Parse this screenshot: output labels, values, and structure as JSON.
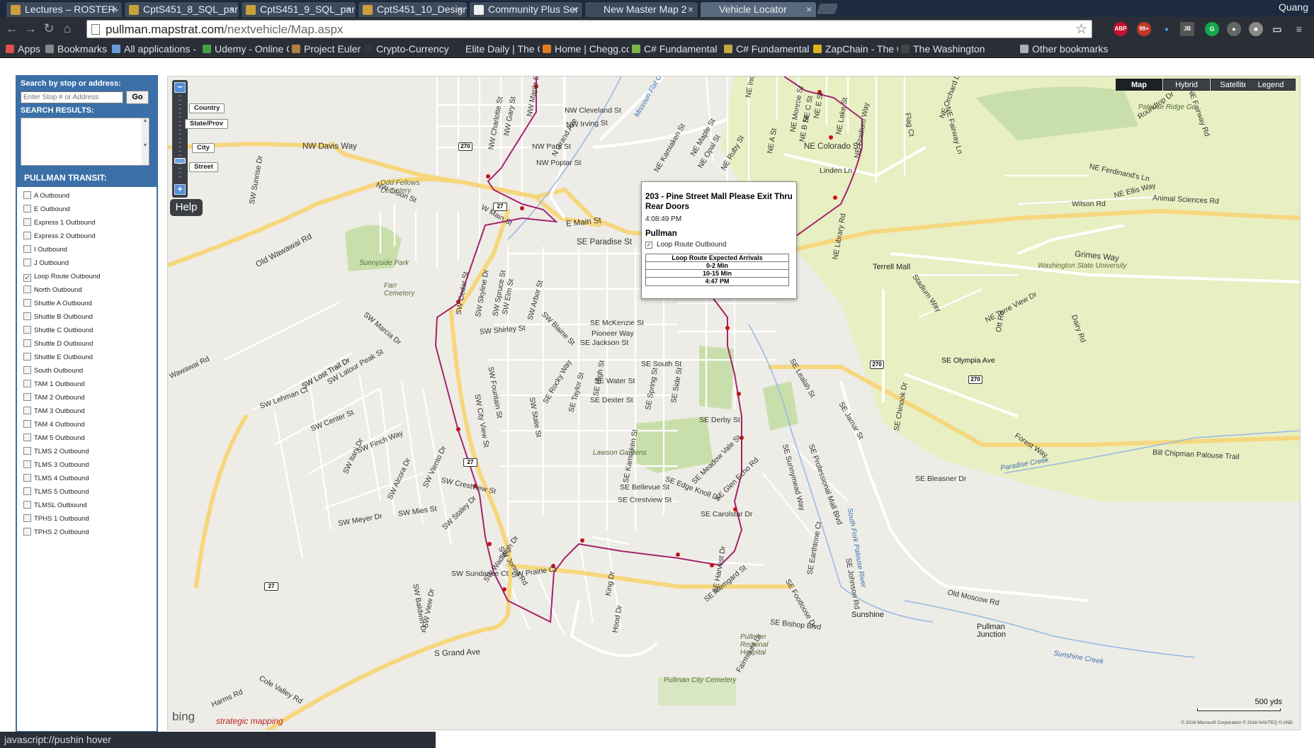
{
  "browser": {
    "tabs": [
      {
        "title": "Lectures – ROSTER-",
        "active": false
      },
      {
        "title": "CptS451_8_SQL_par",
        "active": false
      },
      {
        "title": "CptS451_9_SQL_par",
        "active": false
      },
      {
        "title": "CptS451_10_Design",
        "active": false
      },
      {
        "title": "Community Plus Ser",
        "active": false
      },
      {
        "title": "New Master Map 2",
        "active": false
      },
      {
        "title": "Vehicle Locator",
        "active": true
      }
    ],
    "profile_name": "Quang",
    "url_host": "pullman.mapstrat.com",
    "url_path": "/nextvehicle/Map.aspx",
    "extension_badge": "99+",
    "extension_abp": "ABP",
    "extension_jb": "JB",
    "bookmarks": [
      {
        "label": "Apps",
        "color": "#e05050"
      },
      {
        "label": "Bookmarks",
        "color": "#888888"
      },
      {
        "label": "All applications -",
        "color": "#6a9bd8"
      },
      {
        "label": "Udemy - Online C",
        "color": "#3fa34d"
      },
      {
        "label": "Project Euler",
        "color": "#b08040"
      },
      {
        "label": "Crypto-Currency",
        "color": "#333333"
      },
      {
        "label": "Elite Daily | The C",
        "color": "#2a2f37"
      },
      {
        "label": "Home | Chegg.co",
        "color": "#e27a1f"
      },
      {
        "label": "C# Fundamental",
        "color": "#7ab648"
      },
      {
        "label": "C# Fundamental",
        "color": "#c8a646"
      },
      {
        "label": "ZapChain - The w",
        "color": "#e0b020"
      },
      {
        "label": "The Washington",
        "color": "#444444"
      },
      {
        "label": "Other bookmarks",
        "color": "#b0b0b0"
      }
    ],
    "status_text": "javascript://pushin hover"
  },
  "sidebar": {
    "search_title": "Search by stop or address:",
    "search_placeholder": "Enter Stop # or Address",
    "go_label": "Go",
    "results_title": "SEARCH RESULTS:",
    "transit_title": "PULLMAN TRANSIT:",
    "routes": [
      {
        "label": "A Outbound",
        "checked": false
      },
      {
        "label": "E Outbound",
        "checked": false
      },
      {
        "label": "Express 1 Outbound",
        "checked": false
      },
      {
        "label": "Express 2 Outbound",
        "checked": false
      },
      {
        "label": "I Outbound",
        "checked": false
      },
      {
        "label": "J Outbound",
        "checked": false
      },
      {
        "label": "Loop Route Outbound",
        "checked": true
      },
      {
        "label": "North Outbound",
        "checked": false
      },
      {
        "label": "Shuttle A Outbound",
        "checked": false
      },
      {
        "label": "Shuttle B Outbound",
        "checked": false
      },
      {
        "label": "Shuttle C Outbound",
        "checked": false
      },
      {
        "label": "Shuttle D Outbound",
        "checked": false
      },
      {
        "label": "Shuttle E Outbound",
        "checked": false
      },
      {
        "label": "South Outbound",
        "checked": false
      },
      {
        "label": "TAM 1 Outbound",
        "checked": false
      },
      {
        "label": "TAM 2 Outbound",
        "checked": false
      },
      {
        "label": "TAM 3 Outbound",
        "checked": false
      },
      {
        "label": "TAM 4 Outbound",
        "checked": false
      },
      {
        "label": "TAM 5 Outbound",
        "checked": false
      },
      {
        "label": "TLMS 2 Outbound",
        "checked": false
      },
      {
        "label": "TLMS 3 Outbound",
        "checked": false
      },
      {
        "label": "TLMS 4 Outbound",
        "checked": false
      },
      {
        "label": "TLMS 5 Outbound",
        "checked": false
      },
      {
        "label": "TLMSL Outbound",
        "checked": false
      },
      {
        "label": "TPHS 1 Outbound",
        "checked": false
      },
      {
        "label": "TPHS 2 Outbound",
        "checked": false
      }
    ]
  },
  "map": {
    "zoom_labels": [
      "Country",
      "State/Prov",
      "City",
      "Street"
    ],
    "help_label": "Help",
    "map_types": [
      {
        "label": "Map",
        "active": true
      },
      {
        "label": "Hybrid",
        "active": false
      },
      {
        "label": "Satellite",
        "active": false
      }
    ],
    "legend_label": "Legend",
    "scale_label": "500 yds",
    "copyright": "© 2016 Microsoft Corporation   © 2016 NAVTEQ   © AND",
    "bing_label": "bing",
    "brand_label": "strategic mapping",
    "route_color": "#a3246e",
    "campus_color": "#e8efc2",
    "streets": [
      "NW Davis Way",
      "NW Olson St",
      "W Main St",
      "E Main St",
      "SE Paradise St",
      "Old Wawawai Rd",
      "S Grand Ave",
      "N Grand Ave",
      "NE Colorado St",
      "Grimes Way",
      "SE Olympia Ave",
      "NE Terre View Dr",
      "Stadium Way",
      "NW Cleveland St",
      "NW Irving St",
      "NW Park St",
      "NW Poplar St",
      "NE Ferdinand's Ln",
      "NE Ellis Way",
      "Wilson Rd",
      "Animal Sciences Rd",
      "Roundtop Dr",
      "SE Bleasner Dr",
      "Bill Chipman Palouse Trail",
      "Old Moscow Rd",
      "SE Bishop Blvd",
      "Harms Rd",
      "Cole Valley Rd",
      "SW Crestview St",
      "SE Crestview St",
      "SE Bellevue St",
      "SE Carolstar Dr",
      "SE Derby St",
      "SE Dexter St",
      "SE Water St",
      "SE Jackson St",
      "SE McKenzie St",
      "Pioneer Way",
      "SW Shirley St",
      "SW Center St",
      "SW Finch Way",
      "SW Mies St",
      "SW Meyer Dr",
      "SW Sundance Ct",
      "SW Prairie Ct",
      "Forest Way",
      "SE Fountain St",
      "SW Lost Trail Dr",
      "SW Latour Peak St",
      "SW Marcia Dr",
      "SE Meadow Vale St",
      "SE Glen Echo Rd",
      "SE Sunnymead Way",
      "SE Professional Mall Blvd",
      "SE Edge Knoll Dr",
      "SE Alemgard St",
      "SE Footloose Dr",
      "SE Johnson Rd",
      "Fairmount Dr",
      "NE Opal St",
      "NE Ruby St",
      "NE Maple St",
      "NE Kamiaken St",
      "Linden Ln",
      "Flag Ct",
      "NE Fairway Ln",
      "SE Olympia Ave",
      "Dairy Rd",
      "Ott Rd",
      "NE Terre View",
      "SE South St",
      "SE Spring St",
      "SE High St",
      "SE Taylor St",
      "SE Rocky Way",
      "SW State St",
      "SW Blaine St",
      "SW Arbor St",
      "SW Elm St",
      "SW Spruce St",
      "SW Skyline Dr",
      "SW Cedar St",
      "SW City View St",
      "SW Fountain St",
      "SW Alcora Dr",
      "SW Viento Dr",
      "SW Staley Dr",
      "SW Wadleigh Dr",
      "SW Jones Rd",
      "SW Itani Dr",
      "SW Lehman Ct",
      "SW Lost Trail Dr",
      "Wawawai Rd",
      "SW Sunrise Dr",
      "SW Baldwin Dr",
      "SW View Dr",
      "King Dr",
      "Hood Dr",
      "SE Kamiaken St",
      "SE Side St",
      "SE Harvest Dr",
      "SE Earthtone Ct",
      "SE Lealah St",
      "SE Jamar St",
      "SE Chinook Dr",
      "NE Lake St",
      "NE Library Rd",
      "NE B St",
      "NE A St",
      "NE Monroe St",
      "NE Ind",
      "NE C St",
      "NE E St",
      "NE Stadium Way",
      "NE Orchard Dr",
      "NE Fairway Rd",
      "NW Charlotte St",
      "NW Gary St",
      "NW Maple St"
    ],
    "places": [
      {
        "label": "Odd Fellows Cemetery",
        "kind": "park"
      },
      {
        "label": "Sunnyside Park",
        "kind": "park"
      },
      {
        "label": "Farr Cemetery",
        "kind": "park"
      },
      {
        "label": "Lawson Gardens",
        "kind": "park"
      },
      {
        "label": "Pullman City Cemetery",
        "kind": "park"
      },
      {
        "label": "Pullman Regional Hospital",
        "kind": "park"
      },
      {
        "label": "Terrell Mall",
        "kind": "place"
      },
      {
        "label": "Washington State University",
        "kind": "park"
      },
      {
        "label": "Palouse Ridge Gc",
        "kind": "park"
      },
      {
        "label": "Sunshine",
        "kind": "place"
      },
      {
        "label": "Pullman Junction",
        "kind": "place"
      },
      {
        "label": "Missouri Flat Creek",
        "kind": "water"
      },
      {
        "label": "Paradise Creek",
        "kind": "water"
      },
      {
        "label": "South Fork Palouse River",
        "kind": "water"
      },
      {
        "label": "Sunshine Creek",
        "kind": "water"
      }
    ],
    "highway_shields": [
      "270",
      "27",
      "270",
      "270",
      "27",
      "27"
    ],
    "popup": {
      "title": "203 - Pine Street Mall Please Exit Thru Rear Doors",
      "time": "4:08:49 PM",
      "city": "Pullman",
      "route_label": "Loop Route Outbound",
      "route_checked": true,
      "table_header": "Loop Route Expected Arrivals",
      "arrivals": [
        "0-2 Min",
        "10-15 Min",
        "4:47 PM"
      ]
    }
  }
}
